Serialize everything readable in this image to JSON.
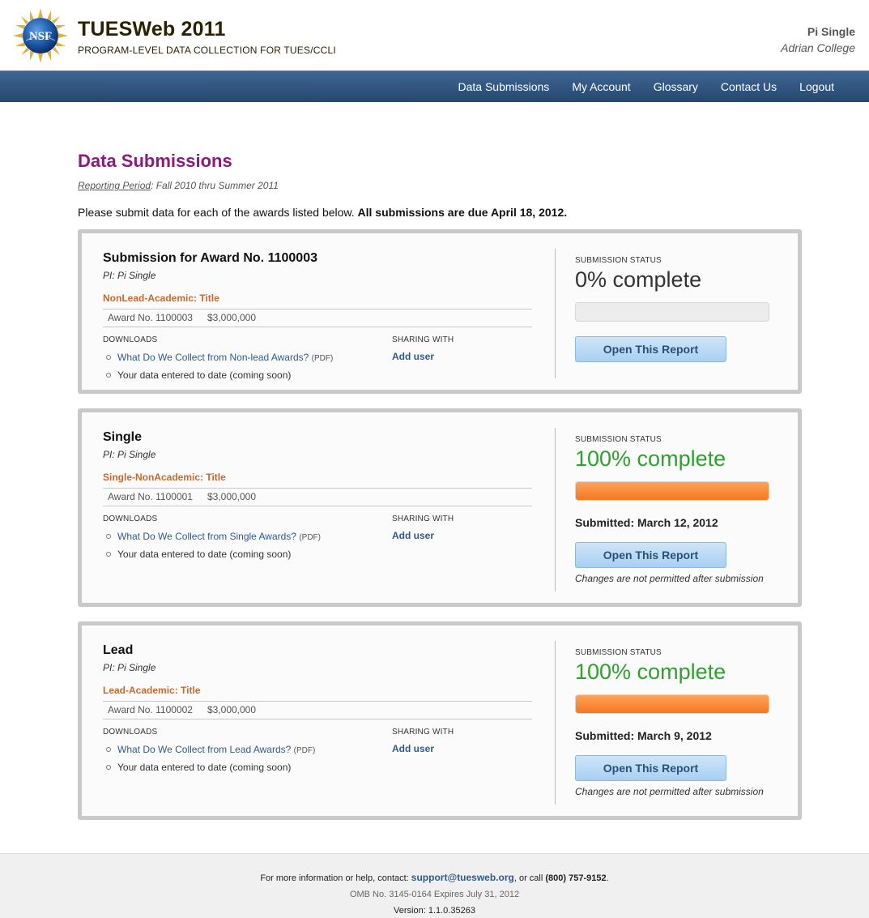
{
  "header": {
    "logo_text": "NSF",
    "app_title": "TUESWeb 2011",
    "app_subtitle": "PROGRAM-LEVEL DATA COLLECTION FOR TUES/CCLI",
    "user_name": "Pi Single",
    "user_org": "Adrian College"
  },
  "nav": {
    "items": [
      {
        "label": "Data Submissions"
      },
      {
        "label": "My Account"
      },
      {
        "label": "Glossary"
      },
      {
        "label": "Contact Us"
      },
      {
        "label": "Logout"
      }
    ]
  },
  "main": {
    "title": "Data Submissions",
    "reporting_label": "Reporting Period",
    "reporting_value": ": Fall 2010 thru Summer 2011",
    "intro_text": "Please submit data for each of the awards listed below. ",
    "intro_bold": "All submissions are due April 18, 2012."
  },
  "labels": {
    "downloads": "DOWNLOADS",
    "sharing_with": "SHARING WITH",
    "add_user": "Add user",
    "submission_status": "SUBMISSION STATUS",
    "open_report": "Open This Report",
    "pdf": "(PDF)",
    "data_to_date": "Your data entered to date (coming soon)",
    "changes_note": "Changes are not permitted after submission"
  },
  "cards": [
    {
      "title": "Submission for Award No. 1100003",
      "pi": "PI: Pi Single",
      "type": "NonLead-Academic: Title",
      "award_no": "Award No. 1100003",
      "amount": "$3,000,000",
      "download_link": "What Do We Collect from Non-lead Awards?",
      "status": "0% complete",
      "progress": 0,
      "submitted": ""
    },
    {
      "title": "Single",
      "pi": "PI: Pi Single",
      "type": "Single-NonAcademic: Title",
      "award_no": "Award No. 1100001",
      "amount": "$3,000,000",
      "download_link": "What Do We Collect from Single Awards?",
      "status": "100% complete",
      "progress": 100,
      "submitted": "Submitted: March 12, 2012"
    },
    {
      "title": "Lead",
      "pi": "PI: Pi Single",
      "type": "Lead-Academic: Title",
      "award_no": "Award No. 1100002",
      "amount": "$3,000,000",
      "download_link": "What Do We Collect from Lead Awards?",
      "status": "100% complete",
      "progress": 100,
      "submitted": "Submitted: March 9, 2012"
    }
  ],
  "footer": {
    "help_prefix": "For more information or help, contact: ",
    "email": "support@tuesweb.org",
    "call_text": ", or call ",
    "phone": "(800) 757-9152",
    "period": ".",
    "omb": "OMB No. 3145-0164 Expires July 31, 2012",
    "version": "Version: 1.1.0.35263"
  }
}
